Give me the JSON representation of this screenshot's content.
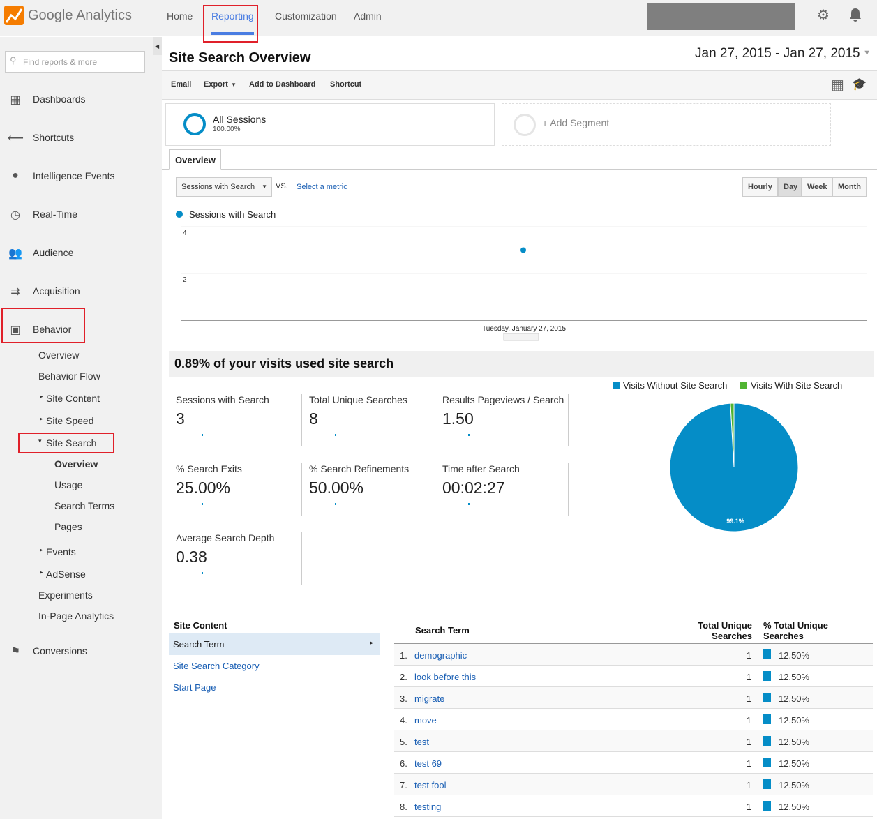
{
  "app": {
    "logo_text": "Google Analytics"
  },
  "topnav": [
    {
      "label": "Home"
    },
    {
      "label": "Reporting",
      "active": true
    },
    {
      "label": "Customization"
    },
    {
      "label": "Admin"
    }
  ],
  "search": {
    "placeholder": "Find reports & more"
  },
  "sidebar": {
    "items": [
      {
        "label": "Dashboards",
        "icon": "grid-icon"
      },
      {
        "label": "Shortcuts",
        "icon": "shortcut-arrow-icon"
      },
      {
        "label": "Intelligence Events",
        "icon": "lightbulb-icon"
      },
      {
        "label": "Real-Time",
        "icon": "clock-icon"
      },
      {
        "label": "Audience",
        "icon": "people-icon"
      },
      {
        "label": "Acquisition",
        "icon": "acquisition-arrows-icon"
      },
      {
        "label": "Behavior",
        "icon": "behavior-layout-icon"
      },
      {
        "label": "Conversions",
        "icon": "flag-icon"
      }
    ],
    "behavior_sub": [
      "Overview",
      "Behavior Flow",
      "Site Content",
      "Site Speed",
      "Site Search",
      "Events",
      "AdSense",
      "Experiments",
      "In-Page Analytics"
    ],
    "site_search_sub": [
      "Overview",
      "Usage",
      "Search Terms",
      "Pages"
    ]
  },
  "page": {
    "title": "Site Search Overview",
    "date_range": "Jan 27, 2015 - Jan 27, 2015"
  },
  "toolbar": {
    "email": "Email",
    "export": "Export",
    "add_dashboard": "Add to Dashboard",
    "shortcut": "Shortcut"
  },
  "segments": {
    "all": "All Sessions",
    "all_pct": "100.00%",
    "add": "+ Add Segment"
  },
  "tabs": {
    "overview": "Overview"
  },
  "chart_controls": {
    "metric": "Sessions with Search",
    "vs": "VS.",
    "select_metric": "Select a metric",
    "hourly": "Hourly",
    "day": "Day",
    "week": "Week",
    "month": "Month"
  },
  "chart_data": [
    {
      "type": "line",
      "series": [
        {
          "name": "Sessions with Search",
          "x": [
            "Tuesday, January 27, 2015"
          ],
          "values": [
            3
          ]
        }
      ],
      "y_ticks": [
        "4",
        "2"
      ],
      "ylim": [
        0,
        4
      ],
      "x_label": "Tuesday, January 27, 2015",
      "color": "#058dc7",
      "grid": true
    },
    {
      "type": "pie",
      "slices": [
        {
          "name": "Visits Without Site Search",
          "value": 99.1,
          "color": "#058dc7",
          "label": "99.1%"
        },
        {
          "name": "Visits With Site Search",
          "value": 0.9,
          "color": "#50b432"
        }
      ],
      "legend": "top"
    }
  ],
  "summary": {
    "headline": "0.89% of your visits used site search"
  },
  "metrics": [
    {
      "label": "Sessions with Search",
      "value": "3"
    },
    {
      "label": "Total Unique Searches",
      "value": "8"
    },
    {
      "label": "Results Pageviews / Search",
      "value": "1.50"
    },
    {
      "label": "% Search Exits",
      "value": "25.00%"
    },
    {
      "label": "% Search Refinements",
      "value": "50.00%"
    },
    {
      "label": "Time after Search",
      "value": "00:02:27"
    },
    {
      "label": "Average Search Depth",
      "value": "0.38"
    }
  ],
  "site_content": {
    "heading": "Site Content",
    "items": [
      "Search Term",
      "Site Search Category",
      "Start Page"
    ]
  },
  "table": {
    "col_term": "Search Term",
    "col_unique": "Total Unique Searches",
    "col_pct": "% Total Unique Searches",
    "rows": [
      {
        "n": "1.",
        "term": "demographic",
        "v": "1",
        "p": "12.50%"
      },
      {
        "n": "2.",
        "term": "look before this",
        "v": "1",
        "p": "12.50%"
      },
      {
        "n": "3.",
        "term": "migrate",
        "v": "1",
        "p": "12.50%"
      },
      {
        "n": "4.",
        "term": "move",
        "v": "1",
        "p": "12.50%"
      },
      {
        "n": "5.",
        "term": "test",
        "v": "1",
        "p": "12.50%"
      },
      {
        "n": "6.",
        "term": "test 69",
        "v": "1",
        "p": "12.50%"
      },
      {
        "n": "7.",
        "term": "test fool",
        "v": "1",
        "p": "12.50%"
      },
      {
        "n": "8.",
        "term": "testing",
        "v": "1",
        "p": "12.50%"
      }
    ]
  }
}
